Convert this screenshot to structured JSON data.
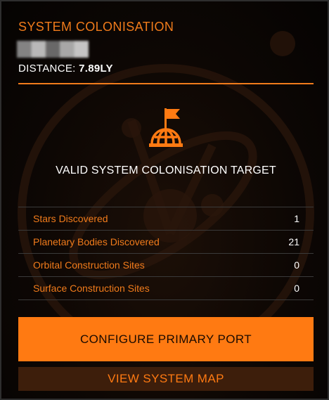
{
  "header": {
    "title": "SYSTEM COLONISATION",
    "distance_label": "DISTANCE:",
    "distance_value": "7.89LY"
  },
  "status": {
    "icon": "colonisation-flag-icon",
    "text": "VALID SYSTEM COLONISATION TARGET"
  },
  "stats": [
    {
      "label": "Stars Discovered",
      "value": "1"
    },
    {
      "label": "Planetary Bodies Discovered",
      "value": "21"
    },
    {
      "label": "Orbital Construction Sites",
      "value": "0"
    },
    {
      "label": "Surface Construction Sites",
      "value": "0"
    }
  ],
  "actions": {
    "primary_label": "CONFIGURE PRIMARY PORT",
    "secondary_label": "VIEW SYSTEM MAP"
  },
  "colors": {
    "accent": "#f07b1b",
    "button_primary_bg": "#ff7a12",
    "button_secondary_bg": "#3d1e0b",
    "text": "#ffffff"
  }
}
